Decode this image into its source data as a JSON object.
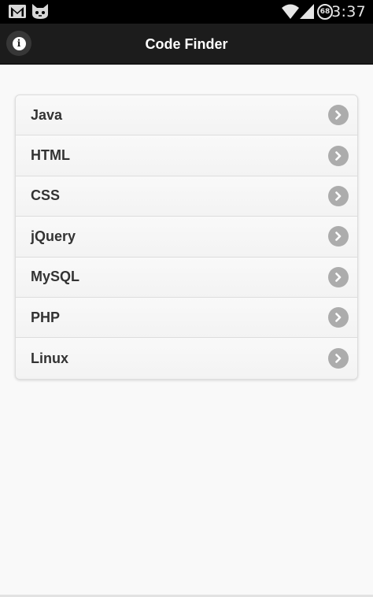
{
  "status_bar": {
    "time": "3:37",
    "battery_level": "68",
    "icons": [
      "gmail-icon",
      "cat-icon",
      "wifi-icon",
      "signal-icon",
      "battery-icon"
    ]
  },
  "header": {
    "title": "Code Finder",
    "info_icon": "info-icon",
    "info_glyph": "i"
  },
  "list": {
    "items": [
      {
        "label": "Java"
      },
      {
        "label": "HTML"
      },
      {
        "label": "CSS"
      },
      {
        "label": "jQuery"
      },
      {
        "label": "MySQL"
      },
      {
        "label": "PHP"
      },
      {
        "label": "Linux"
      }
    ],
    "chevron_icon": "chevron-right-icon"
  },
  "colors": {
    "header_bg": "#1c1c1c",
    "status_bg": "#000000",
    "page_bg": "#f9f9f9",
    "chevron_bg": "#acacac",
    "label_text": "#333333"
  }
}
